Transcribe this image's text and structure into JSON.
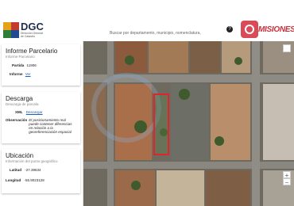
{
  "header": {
    "brand_title": "DGC",
    "brand_sub_1": "Dirección General",
    "brand_sub_2": "de Catastro",
    "search_placeholder": "Buscar por departamento, municipio, nomenclatura, latitud/longitud...",
    "search_icon": "question-icon",
    "partner_logo_text": "MISIONES"
  },
  "informe": {
    "title": "Informe Parcelario",
    "subtitle": "Informe Parcelario",
    "partida_label": "Partida",
    "partida_value": "11906",
    "informe_label": "Informe",
    "informe_link": "Ver"
  },
  "descarga": {
    "title": "Descarga",
    "subtitle": "Descarga de parcela",
    "xml_label": "XML",
    "xml_link": "Descargar",
    "obs_label": "Observación",
    "obs_text": "El posicionamiento real puede contener diferencias en relación a la georeferenciación espacial"
  },
  "ubicacion": {
    "title": "Ubicación",
    "subtitle": "Información del punto geográfico",
    "lat_label": "Latitud",
    "lat_value": "-27.39634",
    "lon_label": "Longitud",
    "lon_value": "-55.9023128"
  },
  "map": {
    "zoom_in": "+",
    "zoom_out": "−"
  }
}
